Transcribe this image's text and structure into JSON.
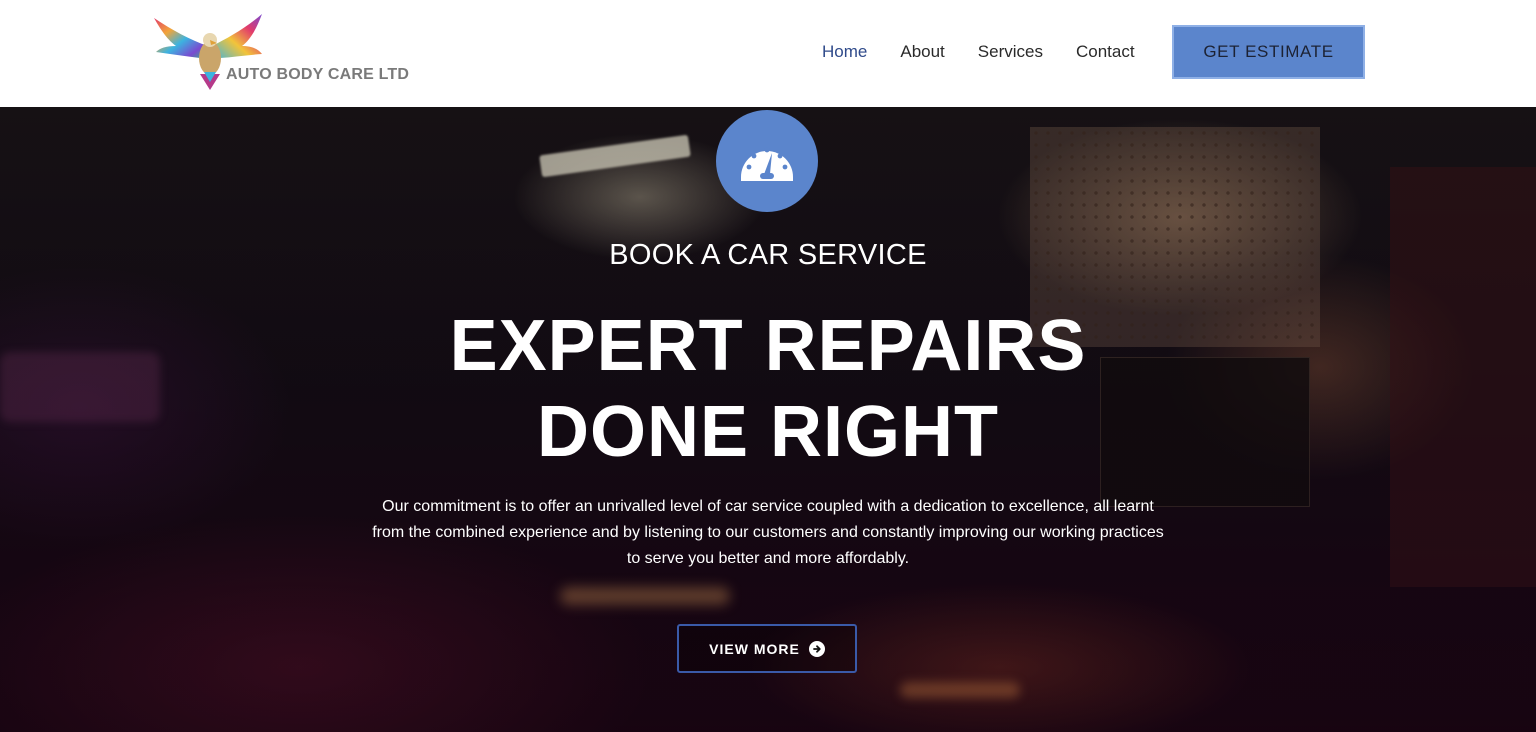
{
  "brand": {
    "name": "AUTO BODY CARE LTD",
    "logo_icon": "eagle-icon"
  },
  "nav": {
    "items": [
      {
        "label": "Home",
        "active": true
      },
      {
        "label": "About",
        "active": false
      },
      {
        "label": "Services",
        "active": false
      },
      {
        "label": "Contact",
        "active": false
      }
    ],
    "cta_label": "GET ESTIMATE"
  },
  "hero": {
    "icon": "speedometer-icon",
    "subtitle": "BOOK A CAR SERVICE",
    "title_line1": "EXPERT REPAIRS",
    "title_line2": "DONE RIGHT",
    "description": "Our commitment is to offer an unrivalled level of car service coupled with a dedication to excellence, all learnt from the combined experience and by listening to our customers and constantly improving our working practices to serve you better and more affordably.",
    "button_label": "VIEW MORE",
    "button_icon": "arrow-circle-right-icon"
  },
  "colors": {
    "accent": "#5b85cc",
    "nav_active": "#2f4a8a",
    "button_border": "#3a5aa8"
  }
}
